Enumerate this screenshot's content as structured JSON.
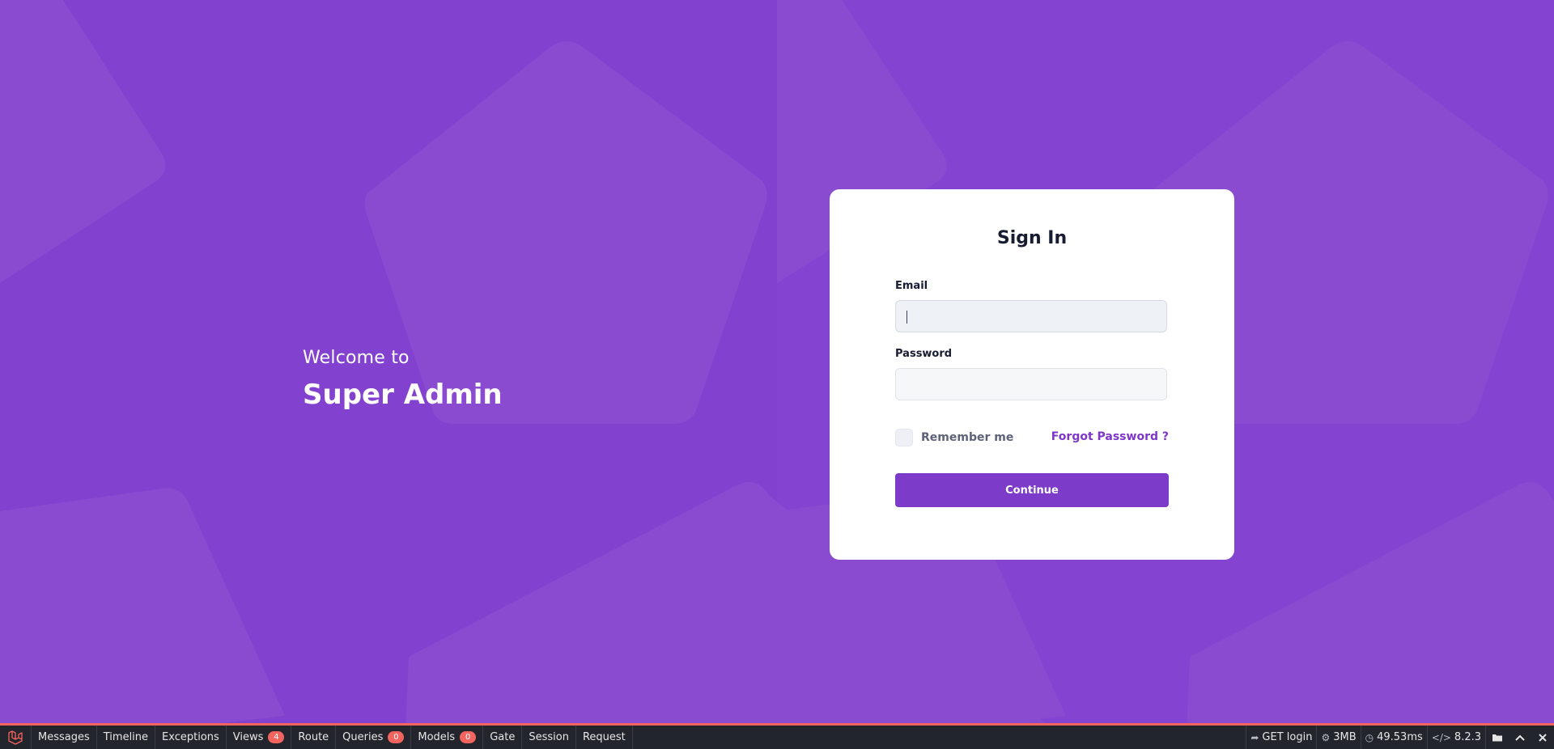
{
  "welcome": {
    "subtitle": "Welcome to",
    "title": "Super Admin"
  },
  "signin": {
    "title": "Sign In",
    "email_label": "Email",
    "email_value": "",
    "password_label": "Password",
    "password_value": "",
    "remember_label": "Remember me",
    "remember_checked": false,
    "forgot_label": "Forgot Password ?",
    "continue_label": "Continue"
  },
  "debugbar": {
    "tabs": [
      {
        "label": "Messages"
      },
      {
        "label": "Timeline"
      },
      {
        "label": "Exceptions"
      },
      {
        "label": "Views",
        "badge": "4"
      },
      {
        "label": "Route"
      },
      {
        "label": "Queries",
        "badge": "0"
      },
      {
        "label": "Models",
        "badge": "0"
      },
      {
        "label": "Gate"
      },
      {
        "label": "Session"
      },
      {
        "label": "Request"
      }
    ],
    "request": "GET login",
    "memory": "3MB",
    "time": "49.53ms",
    "php_version": "8.2.3"
  },
  "colors": {
    "background": "#8341cf",
    "accent": "#7c3bc8",
    "debugbar_accent": "#f4645f"
  }
}
